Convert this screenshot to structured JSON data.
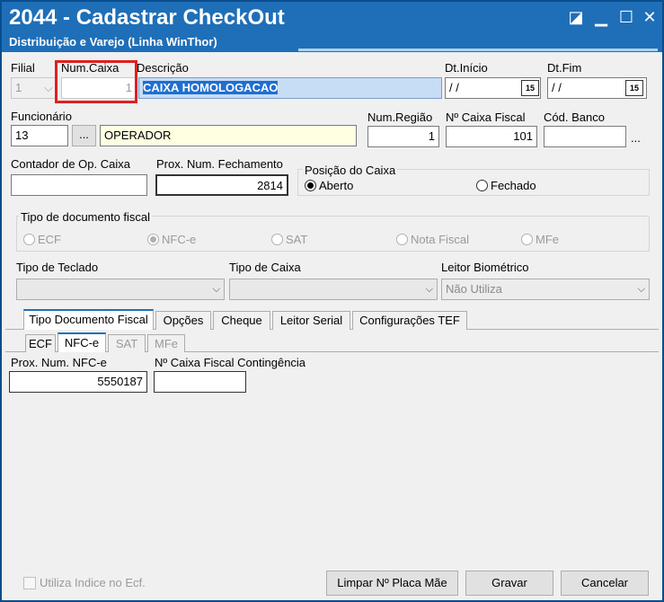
{
  "window": {
    "title": "2044 - Cadastrar CheckOut",
    "subtitle": "Distribuição e Varejo (Linha WinThor)"
  },
  "fields": {
    "filial_label": "Filial",
    "filial_value": "1",
    "num_caixa_label": "Num.Caixa",
    "num_caixa_value": "1",
    "descricao_label": "Descrição",
    "descricao_value": "CAIXA HOMOLOGACAO",
    "dt_inicio_label": "Dt.Início",
    "dt_inicio_value": "/ /",
    "dt_fim_label": "Dt.Fim",
    "dt_fim_value": "/ /",
    "calendar_icon_text": "15",
    "funcionario_label": "Funcionário",
    "funcionario_code": "13",
    "funcionario_lookup": "...",
    "funcionario_name": "OPERADOR",
    "num_regiao_label": "Num.Região",
    "num_regiao_value": "1",
    "num_caixa_fiscal_label": "Nº Caixa Fiscal",
    "num_caixa_fiscal_value": "101",
    "cod_banco_label": "Cód. Banco",
    "cod_banco_value": "",
    "cod_banco_lookup": "...",
    "contador_label": "Contador de Op. Caixa",
    "contador_value": "",
    "prox_fech_label": "Prox. Num. Fechamento",
    "prox_fech_value": "2814"
  },
  "posicao_caixa": {
    "label": "Posição do Caixa",
    "options": [
      "Aberto",
      "Fechado"
    ],
    "selected": "Aberto"
  },
  "tipo_doc_fiscal": {
    "label": "Tipo de documento fiscal",
    "options": [
      "ECF",
      "NFC-e",
      "SAT",
      "Nota Fiscal",
      "MFe"
    ],
    "selected": "NFC-e"
  },
  "combos": {
    "tipo_teclado_label": "Tipo de Teclado",
    "tipo_teclado_value": "",
    "tipo_caixa_label": "Tipo de Caixa",
    "tipo_caixa_value": "",
    "leitor_label": "Leitor Biométrico",
    "leitor_value": "Não Utiliza"
  },
  "tabs": [
    "Tipo Documento Fiscal",
    "Opções",
    "Cheque",
    "Leitor Serial",
    "Configurações TEF"
  ],
  "subtabs": [
    "ECF",
    "NFC-e",
    "SAT",
    "MFe"
  ],
  "nfce": {
    "prox_num_label": "Prox. Num. NFC-e",
    "prox_num_value": "5550187",
    "contingencia_label": "Nº Caixa Fiscal Contingência",
    "contingencia_value": ""
  },
  "footer": {
    "utiliza_indice_label": "Utiliza Indice no Ecf.",
    "limpar_label": "Limpar Nº Placa Mãe",
    "gravar_label": "Gravar",
    "cancelar_label": "Cancelar"
  },
  "colors": {
    "titlebar": "#1f6fb8",
    "highlight": "#e02020"
  }
}
